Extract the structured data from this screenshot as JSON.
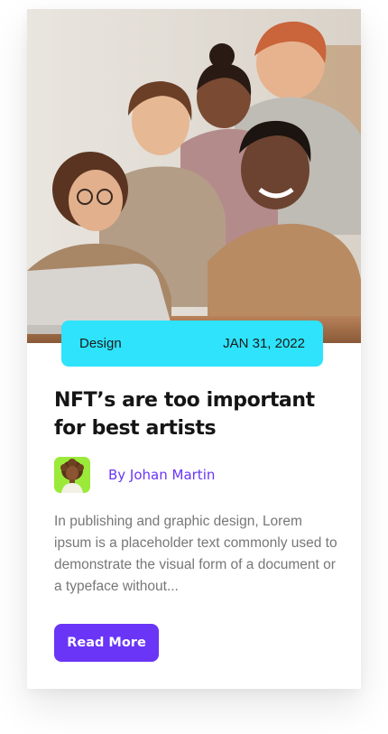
{
  "card": {
    "category": "Design",
    "date": "JAN 31, 2022",
    "title": "NFT’s are too important for best artists",
    "author": "By Johan Martin",
    "excerpt": "In publishing and graphic design, Lorem ipsum is a placeholder text commonly used to demonstrate the visual form of a document or a typeface without...",
    "button_label": "Read More"
  },
  "colors": {
    "meta_bar": "#2ee3fb",
    "accent": "#6a35f6",
    "avatar_bg": "#9bea3a"
  },
  "icons": {
    "hero": "team-photo",
    "avatar": "nft-avatar-icon"
  }
}
